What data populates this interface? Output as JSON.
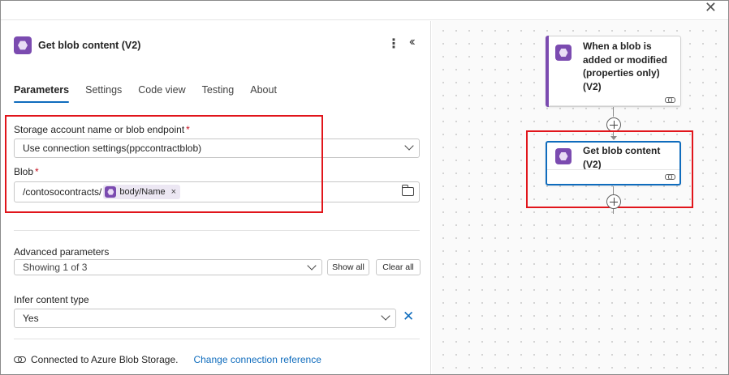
{
  "panel": {
    "title": "Get blob content (V2)",
    "more_icon": "more-vertical-icon",
    "collapse_icon": "double-chevron-left-icon",
    "tabs": [
      {
        "label": "Parameters",
        "active": true
      },
      {
        "label": "Settings",
        "active": false
      },
      {
        "label": "Code view",
        "active": false
      },
      {
        "label": "Testing",
        "active": false
      },
      {
        "label": "About",
        "active": false
      }
    ],
    "storage": {
      "label": "Storage account name or blob endpoint",
      "required_mark": "*",
      "value": "Use connection settings(ppccontractblob)"
    },
    "blob": {
      "label": "Blob",
      "required_mark": "*",
      "prefix": "/contosocontracts/",
      "token": "body/Name",
      "token_remove": "×"
    },
    "advanced": {
      "label": "Advanced parameters",
      "value": "Showing 1 of 3",
      "show_all": "Show all",
      "clear_all": "Clear all"
    },
    "infer": {
      "label": "Infer content type",
      "value": "Yes",
      "clear_icon": "✕"
    },
    "connection": {
      "text": "Connected to Azure Blob Storage.",
      "link": "Change connection reference"
    }
  },
  "canvas": {
    "trigger_title": "When a blob is added or modified (properties only) (V2)",
    "action_title": "Get blob content (V2)"
  },
  "colors": {
    "accent": "#0f6cbd",
    "brand_purple": "#7b4bb0",
    "highlight_red": "#e1151b",
    "required_red": "#c50f1f"
  }
}
